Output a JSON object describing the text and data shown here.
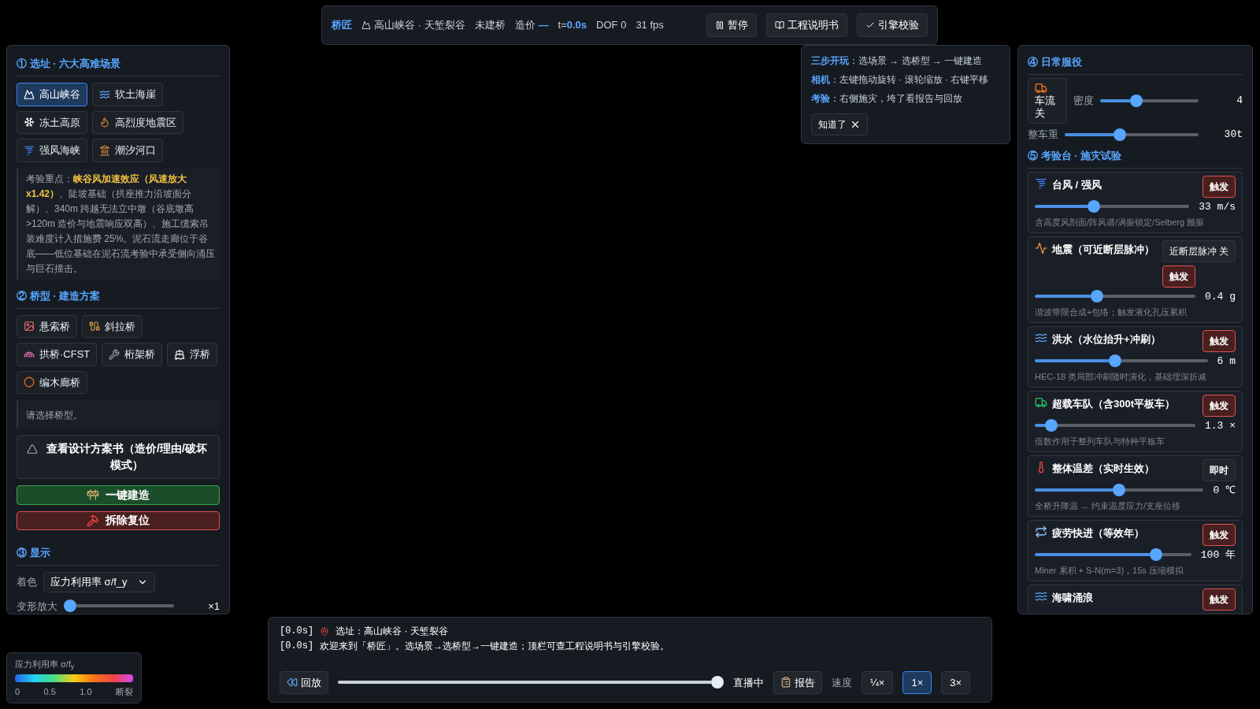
{
  "topbar": {
    "brand": "桥匠",
    "scene": "高山峡谷 · 天堑裂谷",
    "status": "未建桥",
    "cost_label": "造价",
    "cost_value": "—",
    "time_label": "t=",
    "time_value": "0.0s",
    "dof": "DOF 0",
    "fps": "31 fps",
    "buttons": [
      {
        "label": "暂停",
        "kind": "pause"
      },
      {
        "label": "工程说明书",
        "kind": "book"
      },
      {
        "label": "引擎校验",
        "kind": "check"
      }
    ]
  },
  "site": {
    "title": "① 选址 · 六大高难场景",
    "scenes": [
      {
        "label": "高山峡谷",
        "selected": true
      },
      {
        "label": "软土海崖",
        "selected": false
      },
      {
        "label": "冻土高原",
        "selected": false
      },
      {
        "label": "高烈度地震区",
        "selected": false
      },
      {
        "label": "强风海峡",
        "selected": false
      },
      {
        "label": "潮汐河口",
        "selected": false
      }
    ],
    "note": "考验重点：**峡谷风加速效应（风速放大 x1.42）**、陡坡基础（拱座推力沿坡面分解）、340m 跨越无法立中墩（谷底墩高>120m 造价与地震响应双高）、施工缆索吊装难度计入措施费 25%。泥石流走廊位于谷底——低位基础在泥石流考验中承受侧向涌压与巨石撞击。"
  },
  "bridge": {
    "title": "② 桥型 · 建造方案",
    "types": [
      {
        "label": "悬索桥",
        "selected": false
      },
      {
        "label": "斜拉桥",
        "selected": false
      },
      {
        "label": "拱桥·CFST",
        "selected": false
      },
      {
        "label": "桁架桥",
        "selected": false
      },
      {
        "label": "浮桥",
        "selected": false
      },
      {
        "label": "编木廊桥",
        "selected": false
      }
    ],
    "note": "请选择桥型。",
    "plan_button": "查看设计方案书（造价/理由/破坏模式）",
    "build_button": "一键建造",
    "reset_button": "拆除复位"
  },
  "display": {
    "title": "③ 显示",
    "color_label": "着色",
    "color_value": "应力利用率 σ/f_y",
    "deform": {
      "label": "变形放大",
      "level": 0,
      "value": "×1"
    }
  },
  "legend": {
    "title": "应力利用率 σ/f$_{y}$",
    "ticks": [
      "0",
      "0.5",
      "1.0",
      "断裂"
    ]
  },
  "help": {
    "lines": [
      {
        "label": "三步开玩",
        "text": "：选场景 → 选桥型 → 一键建造"
      },
      {
        "label": "相机",
        "text": "：左键拖动旋转 · 滚轮缩放 · 右键平移"
      },
      {
        "label": "考验",
        "text": "：右侧施灾，垮了看报告与回放"
      }
    ],
    "dismiss": "知道了"
  },
  "service": {
    "title": "④ 日常服役",
    "traffic_button": "车流关",
    "density": {
      "label": "密度",
      "level": 0.35,
      "value": "4"
    },
    "weight": {
      "label": "整车重",
      "level": 0.4,
      "value": "30t"
    }
  },
  "tests": {
    "title": "⑤ 考验台 · 施灾试验",
    "items": [
      {
        "name": "台风 / 强风",
        "kind": "trigger",
        "button": "触发",
        "level": 0.37,
        "value": "33 m/s",
        "note": "含高度风剖面/阵风谱/涡振锁定/Selberg 颤振"
      },
      {
        "name": "地震（可近断层脉冲）",
        "kind": "trigger",
        "toggle": "近断层脉冲 关",
        "button": "触发",
        "level": 0.38,
        "value": "0.4 g",
        "note": "谐波带限合成+包络；触发液化孔压累积"
      },
      {
        "name": "洪水（水位抬升+冲刷）",
        "kind": "trigger",
        "button": "触发",
        "level": 0.46,
        "value": "6 m",
        "note": "HEC-18 类局部冲刷随时演化，基础埋深折减"
      },
      {
        "name": "超载车队（含300t平板车）",
        "kind": "trigger",
        "button": "触发",
        "level": 0.07,
        "value": "1.3 ×",
        "note": "倍数作用于整列车队与特种平板车"
      },
      {
        "name": "整体温差（实时生效）",
        "kind": "instant",
        "button": "即时",
        "level": 0.5,
        "value": "0 ℃",
        "note": "全桥升降温 → 约束温度应力/支座位移"
      },
      {
        "name": "疲劳快进（等效年）",
        "kind": "trigger",
        "button": "触发",
        "level": 0.8,
        "value": "100 年",
        "note": "Miner 累积 + S-N(m=3)，15s 压缩模拟"
      },
      {
        "name": "海啸涌浪",
        "kind": "trigger",
        "button": "触发"
      }
    ]
  },
  "log": {
    "lines": [
      {
        "time": "[0.0s]",
        "kind": "pin",
        "text": "选址：高山峡谷 · 天堑裂谷"
      },
      {
        "time": "[0.0s]",
        "kind": "plain",
        "text": "欢迎来到「桥匠」。选场景→选桥型→一键建造；顶栏可查工程说明书与引擎校验。"
      }
    ],
    "replay_button": "回放",
    "replay": {
      "level": 1
    },
    "live": "直播中",
    "report_button": "报告",
    "speed_label": "速度",
    "speeds": [
      {
        "label": "¼×",
        "selected": false
      },
      {
        "label": "1×",
        "selected": true
      },
      {
        "label": "3×",
        "selected": false
      }
    ]
  }
}
